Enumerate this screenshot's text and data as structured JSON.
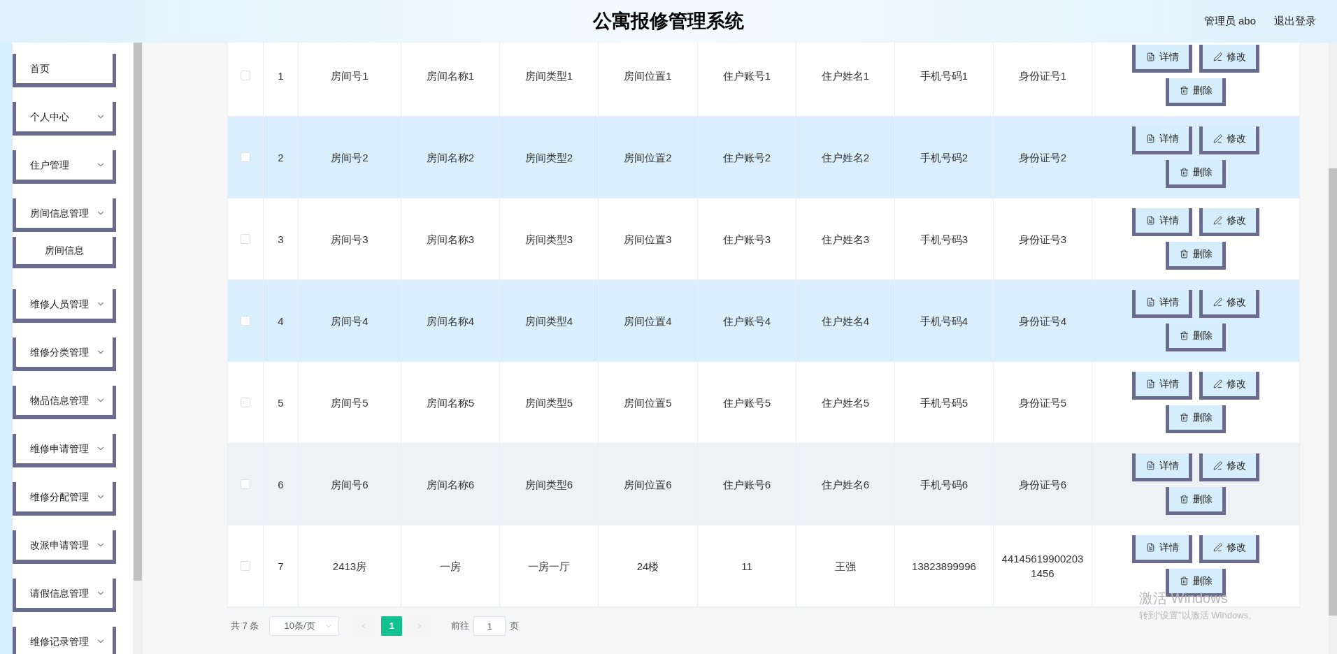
{
  "header": {
    "title": "公寓报修管理系统",
    "user": "管理员 abo",
    "logout": "退出登录"
  },
  "sidebar": {
    "items": [
      {
        "label": "首页",
        "expandable": false
      },
      {
        "label": "个人中心",
        "expandable": true
      },
      {
        "label": "住户管理",
        "expandable": true
      },
      {
        "label": "房间信息管理",
        "expandable": true,
        "children": [
          {
            "label": "房间信息"
          }
        ]
      },
      {
        "label": "维修人员管理",
        "expandable": true
      },
      {
        "label": "维修分类管理",
        "expandable": true
      },
      {
        "label": "物品信息管理",
        "expandable": true
      },
      {
        "label": "维修申请管理",
        "expandable": true
      },
      {
        "label": "维修分配管理",
        "expandable": true
      },
      {
        "label": "改派申请管理",
        "expandable": true
      },
      {
        "label": "请假信息管理",
        "expandable": true
      },
      {
        "label": "维修记录管理",
        "expandable": true
      }
    ]
  },
  "table": {
    "rows": [
      {
        "checked": false,
        "color": "#ffffff",
        "cells": [
          "1",
          "房间号1",
          "房间名称1",
          "房间类型1",
          "房间位置1",
          "住户账号1",
          "住户姓名1",
          "手机号码1",
          "身份证号1"
        ],
        "actions": [
          "详情",
          "修改",
          "删除"
        ]
      },
      {
        "checked": false,
        "color": "#d9effb",
        "cells": [
          "2",
          "房间号2",
          "房间名称2",
          "房间类型2",
          "房间位置2",
          "住户账号2",
          "住户姓名2",
          "手机号码2",
          "身份证号2"
        ],
        "actions": [
          "详情",
          "修改",
          "删除"
        ]
      },
      {
        "checked": false,
        "color": "#ffffff",
        "cells": [
          "3",
          "房间号3",
          "房间名称3",
          "房间类型3",
          "房间位置3",
          "住户账号3",
          "住户姓名3",
          "手机号码3",
          "身份证号3"
        ],
        "actions": [
          "详情",
          "修改",
          "删除"
        ]
      },
      {
        "checked": false,
        "color": "#d9effb",
        "cells": [
          "4",
          "房间号4",
          "房间名称4",
          "房间类型4",
          "房间位置4",
          "住户账号4",
          "住户姓名4",
          "手机号码4",
          "身份证号4"
        ],
        "actions": [
          "详情",
          "修改",
          "删除"
        ]
      },
      {
        "checked": false,
        "color": "#ffffff",
        "cells": [
          "5",
          "房间号5",
          "房间名称5",
          "房间类型5",
          "房间位置5",
          "住户账号5",
          "住户姓名5",
          "手机号码5",
          "身份证号5"
        ],
        "actions": [
          "详情",
          "修改",
          "删除"
        ]
      },
      {
        "checked": false,
        "color": "#eef2f5",
        "cells": [
          "6",
          "房间号6",
          "房间名称6",
          "房间类型6",
          "房间位置6",
          "住户账号6",
          "住户姓名6",
          "手机号码6",
          "身份证号6"
        ],
        "actions": [
          "详情",
          "修改",
          "删除"
        ]
      },
      {
        "checked": false,
        "color": "#ffffff",
        "cells": [
          "7",
          "2413房",
          "一房",
          "一房一厅",
          "24楼",
          "11",
          "王强",
          "13823899996",
          "441456199002031456"
        ],
        "actions": [
          "详情",
          "修改",
          "删除"
        ]
      }
    ]
  },
  "pagination": {
    "total": "共 7 条",
    "page_size": "10条/页",
    "pages": [
      {
        "label": "1",
        "selected": true
      }
    ],
    "goto_label": "前往",
    "goto_value": "1",
    "goto_suffix": "页"
  },
  "os_notice": {
    "title": "激活 Windows",
    "message": "转到“设置”以激活 Windows。"
  }
}
